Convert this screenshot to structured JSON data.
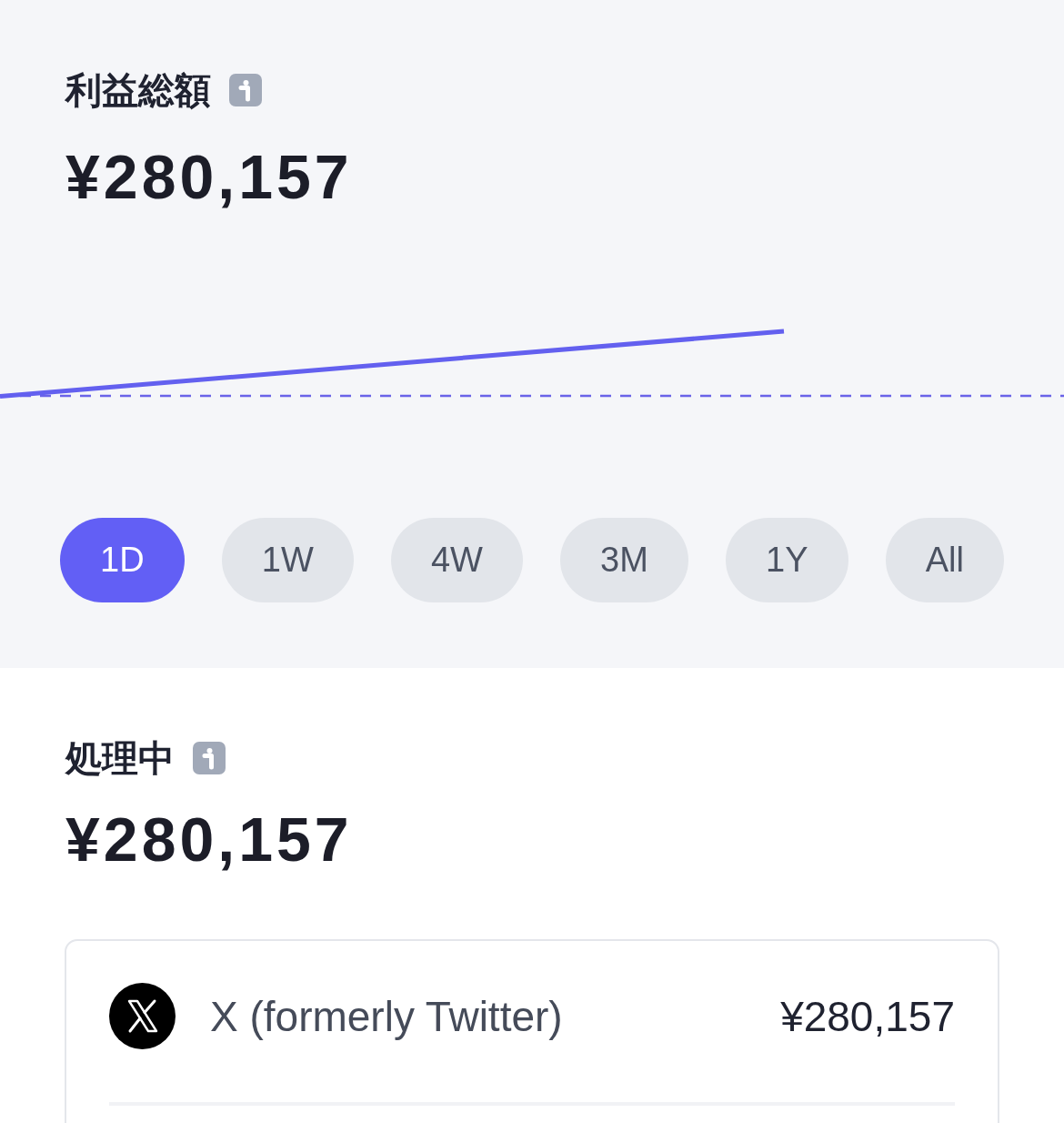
{
  "summary": {
    "title": "利益総額",
    "amount": "¥280,157"
  },
  "range_tabs": [
    {
      "label": "1D",
      "selected": true
    },
    {
      "label": "1W",
      "selected": false
    },
    {
      "label": "4W",
      "selected": false
    },
    {
      "label": "3M",
      "selected": false
    },
    {
      "label": "1Y",
      "selected": false
    },
    {
      "label": "All",
      "selected": false
    }
  ],
  "processing": {
    "title": "処理中",
    "amount": "¥280,157"
  },
  "sources": [
    {
      "name": "X (formerly Twitter)",
      "amount": "¥280,157"
    }
  ]
}
